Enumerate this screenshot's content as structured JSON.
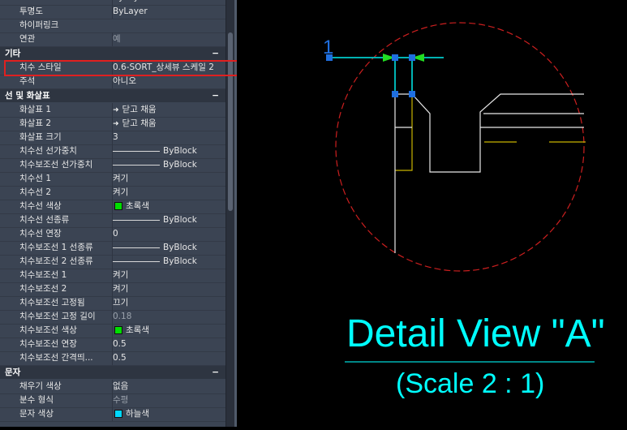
{
  "properties": {
    "top_rows": [
      {
        "label": "투명도",
        "value": "ByLayer",
        "gray": false
      },
      {
        "label": "하이퍼링크",
        "value": "",
        "gray": false
      },
      {
        "label": "연관",
        "value": "예",
        "gray": true
      }
    ],
    "partial_top_value": "ByLayer",
    "sections": {
      "misc": {
        "title": "기타",
        "collapse": "−",
        "rows": [
          {
            "label": "치수 스타일",
            "value": "0.6-SORT_상세뷰 스케일 2"
          },
          {
            "label": "주석",
            "value": "아니오"
          }
        ]
      },
      "lines_arrows": {
        "title": "선 및 화살표",
        "collapse": "−",
        "rows": [
          {
            "label": "화살표 1",
            "value": "닫고 채움",
            "kind": "arrow"
          },
          {
            "label": "화살표 2",
            "value": "닫고 채움",
            "kind": "arrow"
          },
          {
            "label": "화살표 크기",
            "value": "3"
          },
          {
            "label": "치수선 선가중치",
            "value": "ByBlock",
            "kind": "line"
          },
          {
            "label": "치수보조선 선가중치",
            "value": "ByBlock",
            "kind": "line"
          },
          {
            "label": "치수선 1",
            "value": "켜기"
          },
          {
            "label": "치수선 2",
            "value": "켜기"
          },
          {
            "label": "치수선 색상",
            "value": "초록색",
            "kind": "swatch",
            "color": "#00dd00"
          },
          {
            "label": "치수선 선종류",
            "value": "ByBlock",
            "kind": "line"
          },
          {
            "label": "치수선 연장",
            "value": "0"
          },
          {
            "label": "치수보조선 1 선종류",
            "value": "ByBlock",
            "kind": "line"
          },
          {
            "label": "치수보조선 2 선종류",
            "value": "ByBlock",
            "kind": "line"
          },
          {
            "label": "치수보조선 1",
            "value": "켜기"
          },
          {
            "label": "치수보조선 2",
            "value": "켜기"
          },
          {
            "label": "치수보조선 고정됨",
            "value": "끄기"
          },
          {
            "label": "치수보조선 고정 길이",
            "value": "0.18",
            "gray": true
          },
          {
            "label": "치수보조선 색상",
            "value": "초록색",
            "kind": "swatch",
            "color": "#00dd00"
          },
          {
            "label": "치수보조선 연장",
            "value": "0.5"
          },
          {
            "label": "치수보조선 간격띄...",
            "value": "0.5"
          }
        ]
      },
      "text": {
        "title": "문자",
        "collapse": "−",
        "rows": [
          {
            "label": "채우기 색상",
            "value": "없음"
          },
          {
            "label": "분수 형식",
            "value": "수평",
            "gray": true
          },
          {
            "label": "문자 색상",
            "value": "하늘색",
            "kind": "swatch",
            "color": "#00d8ff"
          }
        ]
      }
    }
  },
  "drawing": {
    "dimension_text": "1",
    "title": "Detail View \"A\"",
    "subtitle": "(Scale 2 : 1)",
    "colors": {
      "detail_circle": "#cc1f1f",
      "geometry": "#e8e8e8",
      "centerline": "#c8b400",
      "dimension": "#00b3b3",
      "grips": "#1f6fe0",
      "title": "#00ffff",
      "arrows": "#22dd22"
    }
  }
}
